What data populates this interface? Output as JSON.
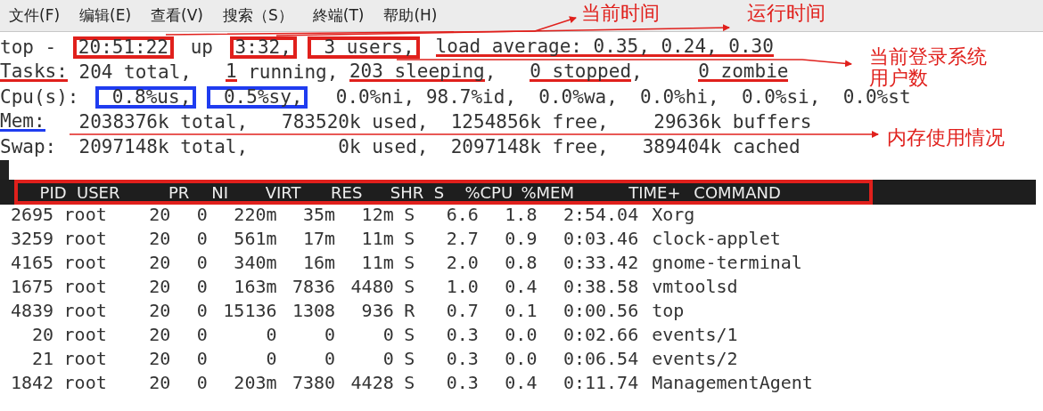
{
  "menu": [
    "文件(F)",
    "编辑(E)",
    "查看(V)",
    "搜索（S）",
    "終端(T)",
    "帮助(H)"
  ],
  "summary_lines": [
    [
      {
        "text": "top - ",
        "kind": "plain"
      },
      {
        "text": "20:51:22",
        "kind": "box",
        "color": "#e0201c"
      },
      {
        "text": " up ",
        "kind": "plain"
      },
      {
        "text": "3:32,",
        "kind": "box",
        "color": "#e0201c"
      },
      {
        "text": " 3 users,",
        "kind": "box",
        "color": "#e0201c"
      },
      {
        "text": "load average: 0.35, 0.24, 0.30",
        "kind": "underline",
        "color": "#e0201c"
      }
    ],
    [
      {
        "text": "Tasks:",
        "kind": "underline",
        "color": "#e0201c"
      },
      {
        "text": " 204 total,   ",
        "kind": "plain"
      },
      {
        "text": "1",
        "kind": "underline",
        "color": "#e0201c"
      },
      {
        "text": " running, ",
        "kind": "plain"
      },
      {
        "text": "203 sleeping",
        "kind": "underline",
        "color": "#e0201c"
      },
      {
        "text": ",   ",
        "kind": "plain"
      },
      {
        "text": "0 stopped",
        "kind": "underline",
        "color": "#e0201c"
      },
      {
        "text": ",    ",
        "kind": "plain"
      },
      {
        "text": "0 zombie",
        "kind": "underline",
        "color": "#e0201c"
      }
    ],
    [
      {
        "text": "Cpu(s): ",
        "kind": "plain"
      },
      {
        "text": " 0.8%us,",
        "kind": "box",
        "color": "#1f3cf0"
      },
      {
        "text": " 0.5%sy,",
        "kind": "box",
        "color": "#1f3cf0"
      },
      {
        "text": "  0.0%ni, 98.7%id,  0.0%wa,  0.0%hi,  0.0%si,  0.0%st",
        "kind": "plain"
      }
    ],
    [
      {
        "text": "Mem:",
        "kind": "underline",
        "color": "#1f3cf0"
      },
      {
        "text": "   2038376k total,   783520k used,  1254856k free,    29636k buffers",
        "kind": "plain"
      }
    ],
    [
      {
        "text": "Swap:  2097148k total,        0k used,  2097148k free,   389404k cached",
        "kind": "plain"
      }
    ]
  ],
  "table": {
    "columns": [
      "PID",
      "USER",
      "PR",
      "NI",
      "VIRT",
      "RES",
      "SHR",
      "S",
      "%CPU",
      "%MEM",
      "TIME+",
      "COMMAND"
    ],
    "rows": [
      [
        "2695",
        "root",
        "20",
        "0",
        "220m",
        "35m",
        "12m",
        "S",
        "6.6",
        "1.8",
        "2:54.04",
        "Xorg"
      ],
      [
        "3259",
        "root",
        "20",
        "0",
        "561m",
        "17m",
        "11m",
        "S",
        "2.7",
        "0.9",
        "0:03.46",
        "clock-applet"
      ],
      [
        "4165",
        "root",
        "20",
        "0",
        "340m",
        "16m",
        "11m",
        "S",
        "2.0",
        "0.8",
        "0:33.42",
        "gnome-terminal"
      ],
      [
        "1675",
        "root",
        "20",
        "0",
        "163m",
        "7836",
        "4480",
        "S",
        "1.0",
        "0.4",
        "0:38.58",
        "vmtoolsd"
      ],
      [
        "4839",
        "root",
        "20",
        "0",
        "15136",
        "1308",
        "936",
        "R",
        "0.7",
        "0.1",
        "0:00.56",
        "top"
      ],
      [
        "20",
        "root",
        "20",
        "0",
        "0",
        "0",
        "0",
        "S",
        "0.3",
        "0.0",
        "0:02.66",
        "events/1"
      ],
      [
        "21",
        "root",
        "20",
        "0",
        "0",
        "0",
        "0",
        "S",
        "0.3",
        "0.0",
        "0:06.54",
        "events/2"
      ],
      [
        "1842",
        "root",
        "20",
        "0",
        "203m",
        "7380",
        "4428",
        "S",
        "0.3",
        "0.4",
        "0:11.74",
        "ManagementAgent"
      ]
    ]
  },
  "annotations": [
    "当前时间",
    "运行时间",
    "当前登录系统用户数",
    "内存使用情况"
  ]
}
